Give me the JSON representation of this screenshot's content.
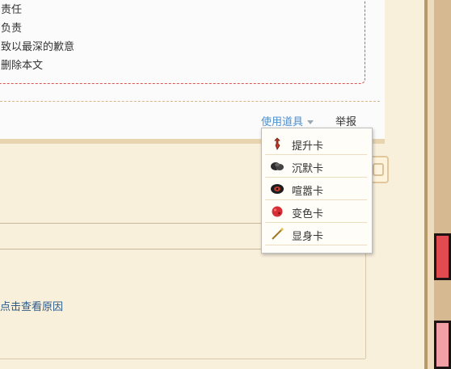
{
  "notice": {
    "lines": [
      "责任",
      "负责",
      "致以最深的歉意",
      "删除本文"
    ]
  },
  "actions": {
    "use_item_label": "使用道具",
    "report_label": "举报"
  },
  "reason_link": "点击查看原因",
  "dropdown": {
    "items": [
      {
        "label": "提升卡",
        "icon": "promote-card-icon"
      },
      {
        "label": "沉默卡",
        "icon": "silence-card-icon"
      },
      {
        "label": "喧嚣卡",
        "icon": "noise-card-icon"
      },
      {
        "label": "变色卡",
        "icon": "color-card-icon"
      },
      {
        "label": "显身卡",
        "icon": "reveal-card-icon"
      }
    ]
  },
  "colors": {
    "link": "#4a8fd0",
    "notice_border": "#d9534f",
    "background": "#f9f0dc"
  }
}
